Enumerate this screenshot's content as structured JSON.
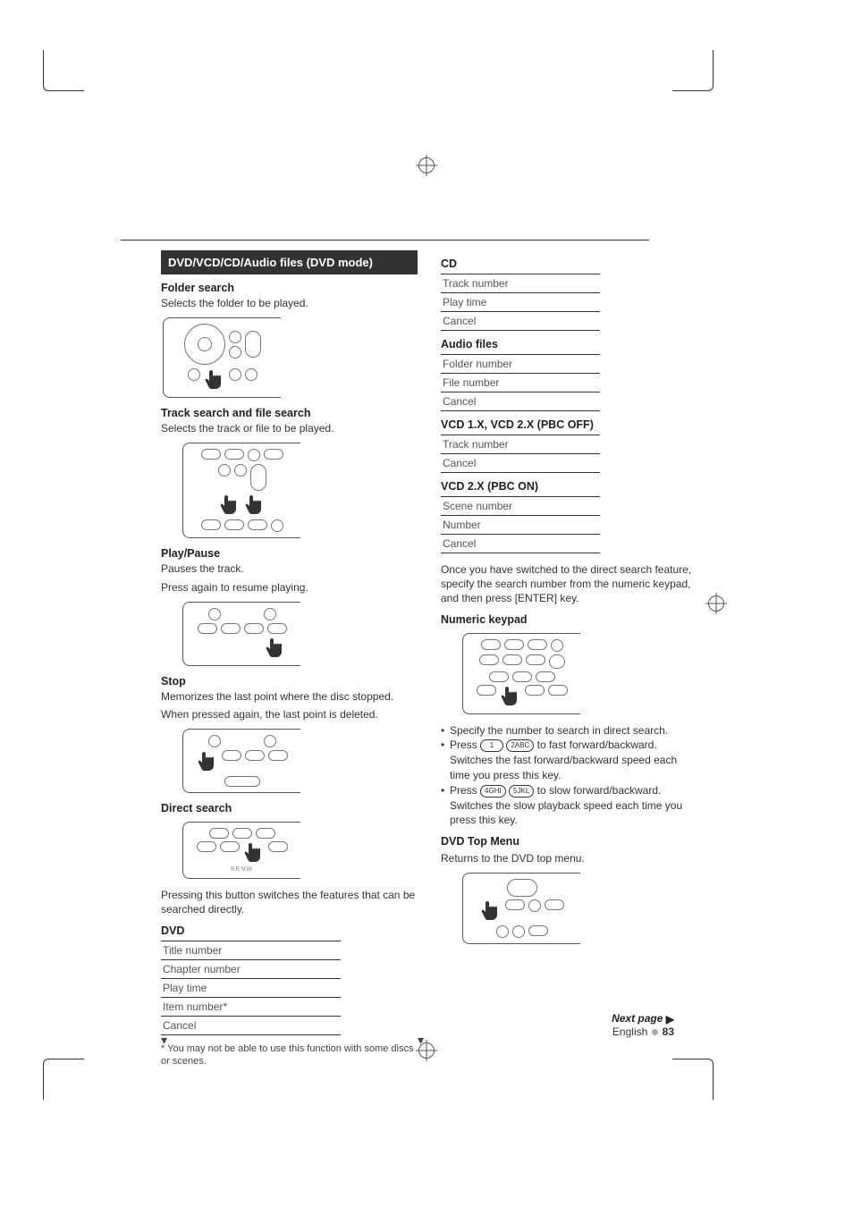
{
  "band_title": "DVD/VCD/CD/Audio files (DVD mode)",
  "left": {
    "folder": {
      "h": "Folder search",
      "t": "Selects the folder to be played."
    },
    "track": {
      "h": "Track search and file search",
      "t": "Selects the track or file to be played."
    },
    "play": {
      "h": "Play/Pause",
      "t1": "Pauses the track.",
      "t2": "Press again to resume playing."
    },
    "stop": {
      "h": "Stop",
      "t1": "Memorizes the last point where the disc stopped.",
      "t2": "When pressed again, the last point is deleted."
    },
    "direct": {
      "h": "Direct search",
      "t": "Pressing this button switches the features that can be searched directly."
    },
    "dvd": {
      "label": "DVD",
      "rows": [
        "Title number",
        "Chapter number",
        "Play time",
        "Item number*",
        "Cancel"
      ]
    },
    "footnote": "* You may not be able to use this function with some discs or scenes."
  },
  "right": {
    "cd": {
      "label": "CD",
      "rows": [
        "Track number",
        "Play time",
        "Cancel"
      ]
    },
    "af": {
      "label": "Audio files",
      "rows": [
        "Folder number",
        "File number",
        "Cancel"
      ]
    },
    "vcd1": {
      "label": "VCD 1.X, VCD 2.X (PBC OFF)",
      "rows": [
        "Track number",
        "Cancel"
      ]
    },
    "vcd2": {
      "label": "VCD 2.X (PBC ON)",
      "rows": [
        "Scene number",
        "Number",
        "Cancel"
      ]
    },
    "para": "Once you have switched to the direct search feature, specify the search number from the numeric keypad, and then press [ENTER] key.",
    "numkey": "Numeric keypad",
    "bullets": {
      "b1": "Specify the number to search in direct search.",
      "b2a": "Press ",
      "b2b": " to fast forward/backward. Switches the fast forward/backward speed each time you press this key.",
      "b3a": "Press ",
      "b3b": " to slow forward/backward. Switches the slow playback speed each time you press this key.",
      "k1": "1",
      "k2": "2ABC",
      "k4": "4GHI",
      "k5": "5JKL"
    },
    "top": {
      "h": "DVD Top Menu",
      "t": "Returns to the DVD top menu."
    }
  },
  "next": "Next page",
  "footer": {
    "lang": "English",
    "page": "83"
  }
}
